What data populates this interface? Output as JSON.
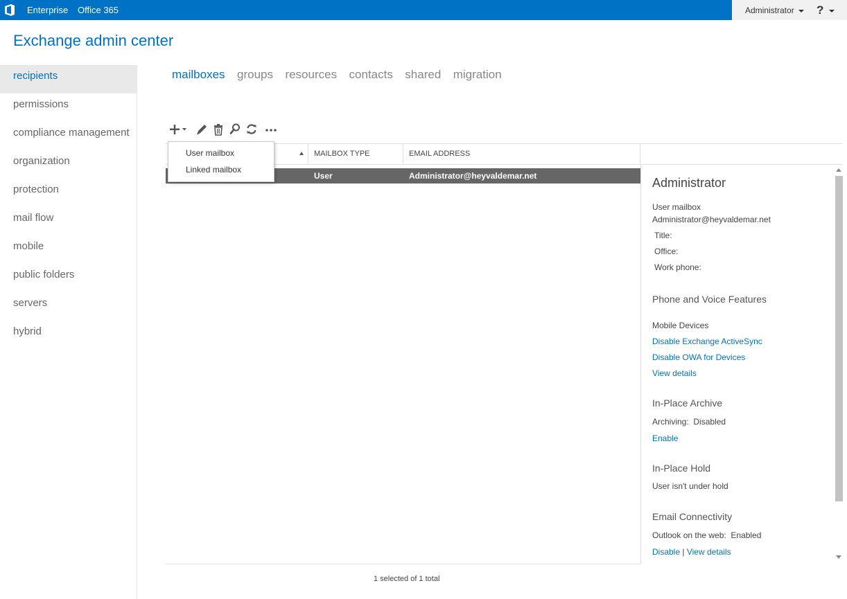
{
  "topbar": {
    "bg_color": "#0072c6",
    "links": [
      "Enterprise",
      "Office 365"
    ],
    "user": "Administrator",
    "help": "?"
  },
  "app": {
    "title": "Exchange admin center"
  },
  "sidebar": {
    "items": [
      {
        "label": "recipients",
        "active": true
      },
      {
        "label": "permissions"
      },
      {
        "label": "compliance management"
      },
      {
        "label": "organization"
      },
      {
        "label": "protection"
      },
      {
        "label": "mail flow"
      },
      {
        "label": "mobile"
      },
      {
        "label": "public folders"
      },
      {
        "label": "servers"
      },
      {
        "label": "hybrid"
      }
    ]
  },
  "tabs": [
    {
      "label": "mailboxes",
      "active": true
    },
    {
      "label": "groups"
    },
    {
      "label": "resources"
    },
    {
      "label": "contacts"
    },
    {
      "label": "shared"
    },
    {
      "label": "migration"
    }
  ],
  "toolbar": {
    "buttons": [
      "add-icon",
      "edit-icon",
      "delete-icon",
      "search-icon",
      "refresh-icon",
      "more-icon"
    ]
  },
  "new_menu": {
    "items": [
      "User mailbox",
      "Linked mailbox"
    ]
  },
  "grid": {
    "columns": [
      "",
      "MAILBOX TYPE",
      "EMAIL ADDRESS"
    ],
    "rows": [
      {
        "mailbox_type": "User",
        "email": "Administrator@heyvaldemar.net",
        "selected": true
      }
    ],
    "status": "1 selected of 1 total"
  },
  "details": {
    "name": "Administrator",
    "type": "User mailbox",
    "email": "Administrator@heyvaldemar.net",
    "title_label": "Title:",
    "office_label": "Office:",
    "work_phone_label": "Work phone:",
    "phone_voice": {
      "heading": "Phone and Voice Features",
      "mobile_devices": "Mobile Devices",
      "disable_activesync": "Disable Exchange ActiveSync",
      "disable_owa_devices": "Disable OWA for Devices",
      "view_details": "View details"
    },
    "archive": {
      "heading": "In-Place Archive",
      "archiving_label": "Archiving:",
      "archiving_value": "Disabled",
      "enable": "Enable"
    },
    "hold": {
      "heading": "In-Place Hold",
      "status": "User isn't under hold"
    },
    "connectivity": {
      "heading": "Email Connectivity",
      "owa_label": "Outlook on the web:",
      "owa_value": "Enabled",
      "disable": "Disable",
      "separator": "|",
      "view_details": "View details"
    }
  }
}
